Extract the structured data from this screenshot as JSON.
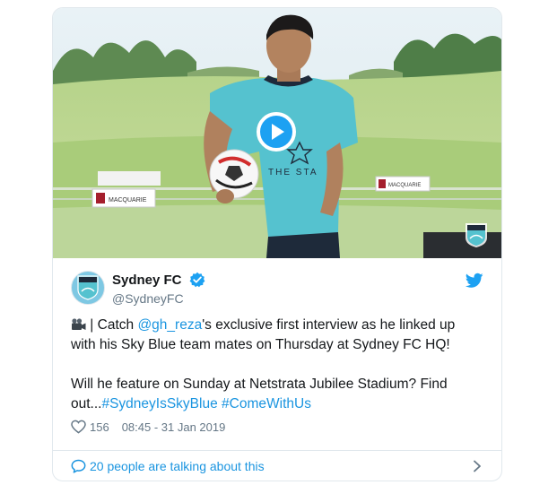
{
  "tweet": {
    "display_name": "Sydney FC",
    "handle": "@SydneyFC",
    "verified": true,
    "body_p1_prefix": " | Catch ",
    "mention": "@gh_reza",
    "body_p1_suffix": "'s exclusive first interview as he linked up with his Sky Blue team mates on Thursday at Sydney FC HQ!",
    "body_p2_prefix": "Will he feature on Sunday at Netstrata Jubilee Stadium? Find out...",
    "hashtag_1": "#SydneyIsSkyBlue",
    "hashtag_2": "#ComeWithUs",
    "likes": "156",
    "timestamp": "08:45 - 31 Jan 2019",
    "talking_label": "20 people are talking about this"
  },
  "media": {
    "type": "video",
    "shirt_sponsor": "THE STA",
    "signage_left": "MACQUARIE",
    "signage_right": "MACQUARIE"
  },
  "icons": {
    "info": "info-icon",
    "play": "play-icon",
    "verified": "verified-badge-icon",
    "twitter": "twitter-bird-icon",
    "camera": "video-camera-emoji",
    "heart": "heart-icon",
    "bubble": "speech-bubble-icon",
    "chevron": "chevron-right-icon"
  },
  "colors": {
    "link": "#1b95e0",
    "twitter_blue": "#1da1f2",
    "secondary_text": "#657786",
    "sky_blue": "#55c2cf"
  }
}
